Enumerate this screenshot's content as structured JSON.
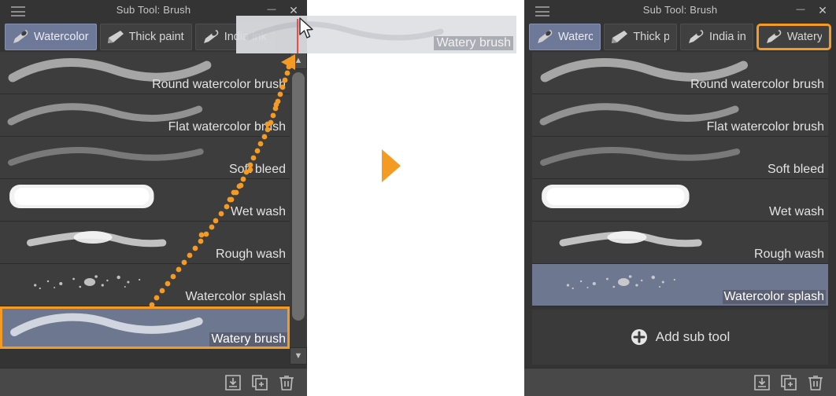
{
  "window": {
    "title": "Sub Tool: Brush",
    "menu_icon": "hamburger-icon",
    "minimize_label": "—",
    "close_label": "✕"
  },
  "colors": {
    "panel_bg": "#343434",
    "row_bg": "#3d3d3d",
    "row_selected": "#6d7790",
    "accent_orange": "#f59a23",
    "tab_active": "#6e7898",
    "drop_marker_red": "#f24b4b"
  },
  "left_panel": {
    "title": "Sub Tool: Brush",
    "tabs": [
      {
        "label": "Watercolor",
        "icon": "watercolor-brush-icon",
        "active": true,
        "highlight": false
      },
      {
        "label": "Thick paint",
        "icon": "thick-paint-icon",
        "active": false,
        "highlight": false
      },
      {
        "label": "India ink",
        "icon": "india-ink-icon",
        "active": false,
        "highlight": false
      }
    ],
    "rows": [
      {
        "label": "Round watercolor brush",
        "stroke": "round",
        "selected": false
      },
      {
        "label": "Flat watercolor brush",
        "stroke": "flat",
        "selected": false
      },
      {
        "label": "Soft bleed",
        "stroke": "soft",
        "selected": false
      },
      {
        "label": "Wet wash",
        "stroke": "wet",
        "selected": false
      },
      {
        "label": "Rough wash",
        "stroke": "rough",
        "selected": false
      },
      {
        "label": "Watercolor splash",
        "stroke": "splash",
        "selected": false
      },
      {
        "label": "Watery brush",
        "stroke": "watery",
        "selected": true
      }
    ],
    "footer_icons": [
      {
        "name": "import-sub-tool-icon",
        "glyph": "import"
      },
      {
        "name": "duplicate-sub-tool-icon",
        "glyph": "duplicate"
      },
      {
        "name": "delete-sub-tool-icon",
        "glyph": "trash"
      }
    ],
    "scroll": {
      "up_glyph": "▲",
      "down_glyph": "▼"
    }
  },
  "drag": {
    "ghost_label": "Watery brush",
    "drop_indicator": "red-vertical-line",
    "cursor": "arrow-pointer"
  },
  "middle": {
    "arrow": "orange-right-triangle"
  },
  "right_panel": {
    "title": "Sub Tool: Brush",
    "tabs": [
      {
        "label": "Waterc",
        "icon": "watercolor-brush-icon",
        "active": true,
        "highlight": false
      },
      {
        "label": "Thick p",
        "icon": "thick-paint-icon",
        "active": false,
        "highlight": false
      },
      {
        "label": "India in",
        "icon": "india-ink-icon",
        "active": false,
        "highlight": false
      },
      {
        "label": "Watery",
        "icon": "watercolor-brush-icon",
        "active": false,
        "highlight": true
      }
    ],
    "rows": [
      {
        "label": "Round watercolor brush",
        "stroke": "round",
        "selected": false
      },
      {
        "label": "Flat watercolor brush",
        "stroke": "flat",
        "selected": false
      },
      {
        "label": "Soft bleed",
        "stroke": "soft",
        "selected": false
      },
      {
        "label": "Wet wash",
        "stroke": "wet",
        "selected": false
      },
      {
        "label": "Rough wash",
        "stroke": "rough",
        "selected": false
      },
      {
        "label": "Watercolor splash",
        "stroke": "splash",
        "selected": true
      }
    ],
    "add_sub_tool_label": "Add sub tool",
    "footer_icons": [
      {
        "name": "import-sub-tool-icon",
        "glyph": "import"
      },
      {
        "name": "duplicate-sub-tool-icon",
        "glyph": "duplicate"
      },
      {
        "name": "delete-sub-tool-icon",
        "glyph": "trash"
      }
    ]
  }
}
